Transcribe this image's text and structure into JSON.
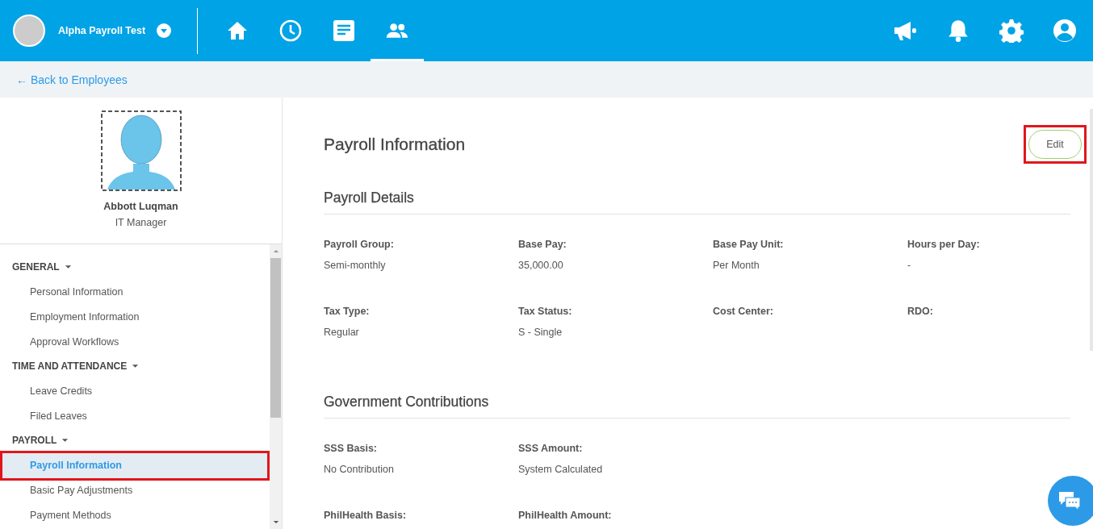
{
  "topbar": {
    "company": "Alpha Payroll Test",
    "nav": [
      {
        "kind": "home",
        "selected": false
      },
      {
        "kind": "clock",
        "selected": false
      },
      {
        "kind": "document",
        "selected": false
      },
      {
        "kind": "people",
        "selected": true
      }
    ]
  },
  "back_link": "← Back to Employees",
  "profile": {
    "name": "Abbott Luqman",
    "title": "IT Manager"
  },
  "sidebar": {
    "groups": [
      {
        "title": "GENERAL",
        "expanded": true,
        "items": [
          {
            "label": "Personal Information",
            "selected": false,
            "annotated": false
          },
          {
            "label": "Employment Information",
            "selected": false,
            "annotated": false
          },
          {
            "label": "Approval Workflows",
            "selected": false,
            "annotated": false
          }
        ]
      },
      {
        "title": "TIME AND ATTENDANCE",
        "expanded": true,
        "items": [
          {
            "label": "Leave Credits",
            "selected": false,
            "annotated": false
          },
          {
            "label": "Filed Leaves",
            "selected": false,
            "annotated": false
          }
        ]
      },
      {
        "title": "PAYROLL",
        "expanded": true,
        "items": [
          {
            "label": "Payroll Information",
            "selected": true,
            "annotated": true
          },
          {
            "label": "Basic Pay Adjustments",
            "selected": false,
            "annotated": false
          },
          {
            "label": "Payment Methods",
            "selected": false,
            "annotated": false
          }
        ]
      }
    ]
  },
  "page": {
    "title": "Payroll Information",
    "edit_button": {
      "label": "Edit",
      "annotated": true
    },
    "sections": [
      {
        "title": "Payroll Details",
        "rows": [
          [
            {
              "label": "Payroll Group:",
              "value": "Semi-monthly"
            },
            {
              "label": "Base Pay:",
              "value": "35,000.00"
            },
            {
              "label": "Base Pay Unit:",
              "value": "Per Month"
            },
            {
              "label": "Hours per Day:",
              "value": "-"
            }
          ],
          [
            {
              "label": "Tax Type:",
              "value": "Regular"
            },
            {
              "label": "Tax Status:",
              "value": "S - Single"
            },
            {
              "label": "Cost Center:"
            },
            {
              "label": "RDO:"
            }
          ]
        ]
      },
      {
        "title": "Government Contributions",
        "rows": [
          [
            {
              "label": "SSS Basis:",
              "value": "No Contribution"
            },
            {
              "label": "SSS Amount:",
              "value": "System Calculated"
            }
          ],
          [
            {
              "label": "PhilHealth Basis:"
            },
            {
              "label": "PhilHealth Amount:"
            }
          ]
        ]
      }
    ]
  }
}
